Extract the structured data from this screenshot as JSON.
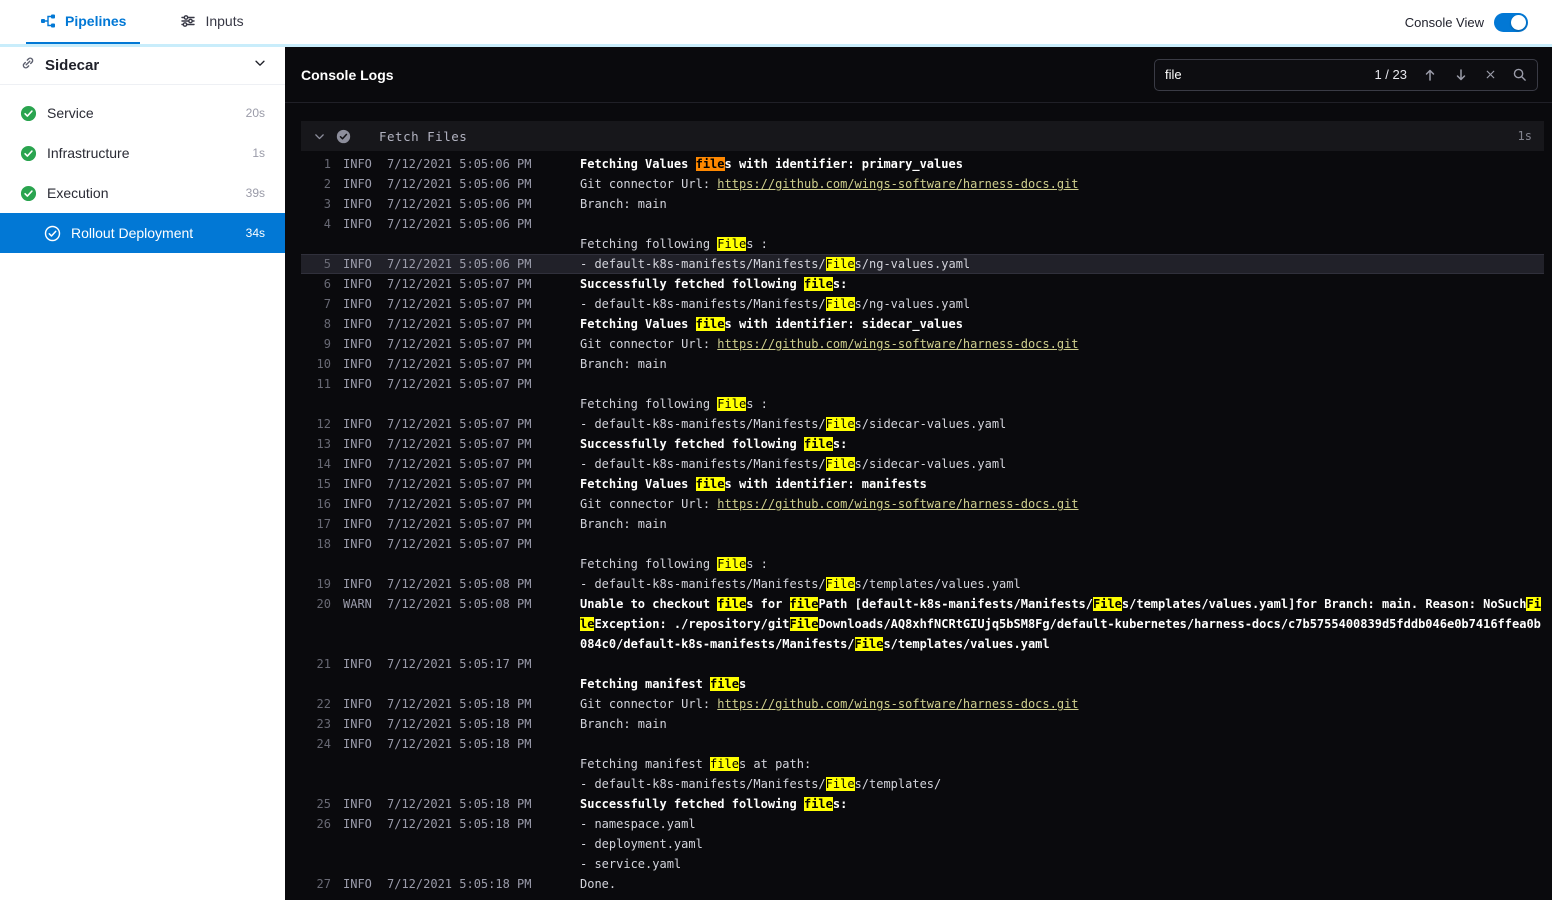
{
  "topbar": {
    "tabs": [
      {
        "label": "Pipelines",
        "active": true
      },
      {
        "label": "Inputs",
        "active": false
      }
    ],
    "console_view_label": "Console View",
    "console_view_on": true
  },
  "sidebar": {
    "title": "Sidecar",
    "items": [
      {
        "label": "Service",
        "duration": "20s",
        "status": "success",
        "selected": false,
        "child": false
      },
      {
        "label": "Infrastructure",
        "duration": "1s",
        "status": "success",
        "selected": false,
        "child": false
      },
      {
        "label": "Execution",
        "duration": "39s",
        "status": "success",
        "selected": false,
        "child": false
      },
      {
        "label": "Rollout Deployment",
        "duration": "34s",
        "status": "success",
        "selected": true,
        "child": true
      }
    ]
  },
  "console": {
    "title": "Console Logs",
    "search": {
      "value": "file",
      "counter": "1 / 23"
    },
    "section": {
      "title": "Fetch Files",
      "duration": "1s"
    },
    "logs": [
      {
        "num": 1,
        "level": "INFO",
        "time": "7/12/2021 5:05:06 PM",
        "lines": [
          {
            "bold": true,
            "segs": [
              {
                "t": "Fetching Values files with identifier: primary_values"
              }
            ]
          }
        ]
      },
      {
        "num": 2,
        "level": "INFO",
        "time": "7/12/2021 5:05:06 PM",
        "lines": [
          {
            "segs": [
              {
                "t": "Git connector Url: "
              },
              {
                "t": "https://github.com/wings-software/harness-docs.git",
                "link": true
              }
            ]
          }
        ]
      },
      {
        "num": 3,
        "level": "INFO",
        "time": "7/12/2021 5:05:06 PM",
        "lines": [
          {
            "segs": [
              {
                "t": "Branch: main"
              }
            ]
          }
        ]
      },
      {
        "num": 4,
        "level": "INFO",
        "time": "7/12/2021 5:05:06 PM",
        "lines": [
          {
            "segs": [
              {
                "t": ""
              }
            ]
          },
          {
            "segs": [
              {
                "t": "Fetching following Files :"
              }
            ]
          }
        ]
      },
      {
        "num": 5,
        "level": "INFO",
        "time": "7/12/2021 5:05:06 PM",
        "selected": true,
        "lines": [
          {
            "segs": [
              {
                "t": "- default-k8s-manifests/Manifests/Files/ng-values.yaml"
              }
            ]
          }
        ]
      },
      {
        "num": 6,
        "level": "INFO",
        "time": "7/12/2021 5:05:07 PM",
        "lines": [
          {
            "bold": true,
            "segs": [
              {
                "t": "Successfully fetched following files:"
              }
            ]
          }
        ]
      },
      {
        "num": 7,
        "level": "INFO",
        "time": "7/12/2021 5:05:07 PM",
        "lines": [
          {
            "segs": [
              {
                "t": "- default-k8s-manifests/Manifests/Files/ng-values.yaml"
              }
            ]
          }
        ]
      },
      {
        "num": 8,
        "level": "INFO",
        "time": "7/12/2021 5:05:07 PM",
        "lines": [
          {
            "bold": true,
            "segs": [
              {
                "t": "Fetching Values files with identifier: sidecar_values"
              }
            ]
          }
        ]
      },
      {
        "num": 9,
        "level": "INFO",
        "time": "7/12/2021 5:05:07 PM",
        "lines": [
          {
            "segs": [
              {
                "t": "Git connector Url: "
              },
              {
                "t": "https://github.com/wings-software/harness-docs.git",
                "link": true
              }
            ]
          }
        ]
      },
      {
        "num": 10,
        "level": "INFO",
        "time": "7/12/2021 5:05:07 PM",
        "lines": [
          {
            "segs": [
              {
                "t": "Branch: main"
              }
            ]
          }
        ]
      },
      {
        "num": 11,
        "level": "INFO",
        "time": "7/12/2021 5:05:07 PM",
        "lines": [
          {
            "segs": [
              {
                "t": ""
              }
            ]
          },
          {
            "segs": [
              {
                "t": "Fetching following Files :"
              }
            ]
          }
        ]
      },
      {
        "num": 12,
        "level": "INFO",
        "time": "7/12/2021 5:05:07 PM",
        "lines": [
          {
            "segs": [
              {
                "t": "- default-k8s-manifests/Manifests/Files/sidecar-values.yaml"
              }
            ]
          }
        ]
      },
      {
        "num": 13,
        "level": "INFO",
        "time": "7/12/2021 5:05:07 PM",
        "lines": [
          {
            "bold": true,
            "segs": [
              {
                "t": "Successfully fetched following files:"
              }
            ]
          }
        ]
      },
      {
        "num": 14,
        "level": "INFO",
        "time": "7/12/2021 5:05:07 PM",
        "lines": [
          {
            "segs": [
              {
                "t": "- default-k8s-manifests/Manifests/Files/sidecar-values.yaml"
              }
            ]
          }
        ]
      },
      {
        "num": 15,
        "level": "INFO",
        "time": "7/12/2021 5:05:07 PM",
        "lines": [
          {
            "bold": true,
            "segs": [
              {
                "t": "Fetching Values files with identifier: manifests"
              }
            ]
          }
        ]
      },
      {
        "num": 16,
        "level": "INFO",
        "time": "7/12/2021 5:05:07 PM",
        "lines": [
          {
            "segs": [
              {
                "t": "Git connector Url: "
              },
              {
                "t": "https://github.com/wings-software/harness-docs.git",
                "link": true
              }
            ]
          }
        ]
      },
      {
        "num": 17,
        "level": "INFO",
        "time": "7/12/2021 5:05:07 PM",
        "lines": [
          {
            "segs": [
              {
                "t": "Branch: main"
              }
            ]
          }
        ]
      },
      {
        "num": 18,
        "level": "INFO",
        "time": "7/12/2021 5:05:07 PM",
        "lines": [
          {
            "segs": [
              {
                "t": ""
              }
            ]
          },
          {
            "segs": [
              {
                "t": "Fetching following Files :"
              }
            ]
          }
        ]
      },
      {
        "num": 19,
        "level": "INFO",
        "time": "7/12/2021 5:05:08 PM",
        "lines": [
          {
            "segs": [
              {
                "t": "- default-k8s-manifests/Manifests/Files/templates/values.yaml"
              }
            ]
          }
        ]
      },
      {
        "num": 20,
        "level": "WARN",
        "time": "7/12/2021 5:05:08 PM",
        "lines": [
          {
            "bold": true,
            "segs": [
              {
                "t": "Unable to checkout files for filePath [default-k8s-manifests/Manifests/Files/templates/values.yaml]for Branch: main. Reason: NoSuchFileException: ./repository/gitFileDownloads/AQ8xhfNCRtGIUjq5bSM8Fg/default-kubernetes/harness-docs/c7b5755400839d5fddb046e0b7416ffea0b084c0/default-k8s-manifests/Manifests/Files/templates/values.yaml"
              }
            ]
          }
        ]
      },
      {
        "num": 21,
        "level": "INFO",
        "time": "7/12/2021 5:05:17 PM",
        "lines": [
          {
            "segs": [
              {
                "t": ""
              }
            ]
          },
          {
            "bold": true,
            "segs": [
              {
                "t": "Fetching manifest files"
              }
            ]
          }
        ]
      },
      {
        "num": 22,
        "level": "INFO",
        "time": "7/12/2021 5:05:18 PM",
        "lines": [
          {
            "segs": [
              {
                "t": "Git connector Url: "
              },
              {
                "t": "https://github.com/wings-software/harness-docs.git",
                "link": true
              }
            ]
          }
        ]
      },
      {
        "num": 23,
        "level": "INFO",
        "time": "7/12/2021 5:05:18 PM",
        "lines": [
          {
            "segs": [
              {
                "t": "Branch: main"
              }
            ]
          }
        ]
      },
      {
        "num": 24,
        "level": "INFO",
        "time": "7/12/2021 5:05:18 PM",
        "lines": [
          {
            "segs": [
              {
                "t": ""
              }
            ]
          },
          {
            "segs": [
              {
                "t": "Fetching manifest files at path:"
              }
            ]
          },
          {
            "segs": [
              {
                "t": "- default-k8s-manifests/Manifests/Files/templates/"
              }
            ]
          }
        ]
      },
      {
        "num": 25,
        "level": "INFO",
        "time": "7/12/2021 5:05:18 PM",
        "lines": [
          {
            "bold": true,
            "segs": [
              {
                "t": "Successfully fetched following files:"
              }
            ]
          }
        ]
      },
      {
        "num": 26,
        "level": "INFO",
        "time": "7/12/2021 5:05:18 PM",
        "lines": [
          {
            "segs": [
              {
                "t": "- namespace.yaml"
              }
            ]
          },
          {
            "segs": [
              {
                "t": "- deployment.yaml"
              }
            ]
          },
          {
            "segs": [
              {
                "t": "- service.yaml"
              }
            ]
          }
        ]
      },
      {
        "num": 27,
        "level": "INFO",
        "time": "7/12/2021 5:05:18 PM",
        "lines": [
          {
            "segs": [
              {
                "t": "Done."
              }
            ]
          }
        ]
      }
    ]
  },
  "colors": {
    "accent": "#0278d5",
    "success_green": "#2aa44f",
    "highlight": "#ffff00",
    "highlight_current": "#ff8800",
    "link": "#cfcf8e",
    "console_bg": "#0a0a0d"
  }
}
